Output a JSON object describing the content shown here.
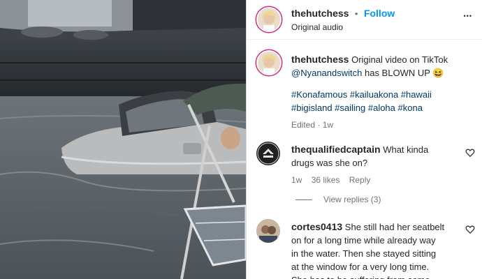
{
  "post": {
    "username": "thehutchess",
    "separator": "•",
    "follow_label": "Follow",
    "audio": "Original audio",
    "more_label": "•••"
  },
  "caption": {
    "username": "thehutchess",
    "text_line1": "Original video on TikTok",
    "mention": "@Nyanandswitch",
    "text_line2_rest": "has BLOWN UP 😆",
    "hashtags_line1": "#Konafamous #kailuakona #hawaii",
    "hashtags_line2": "#bigisland #sailing #aloha #kona",
    "meta": "Edited · 1w"
  },
  "comments": [
    {
      "username": "thequalifiedcaptain",
      "text_line1": "What kinda",
      "text_line2": "drugs was she on?",
      "time": "1w",
      "likes": "36 likes",
      "reply": "Reply",
      "view_replies": "View replies (3)",
      "avatar_text": "QUALIFIED CAPTAIN"
    },
    {
      "username": "cortes0413",
      "text_line1": "She still had her seatbelt",
      "text_line2": "on for a long time while already way",
      "text_line3": "in the water. Then she stayed sitting",
      "text_line4": "at the window for a very long time.",
      "text_line5": "She has to be suffering from some"
    }
  ],
  "colors": {
    "accent_blue": "#0095f6",
    "story_ring": "#d62976",
    "text_primary": "#262626",
    "text_secondary": "#737373"
  },
  "icons": [
    "more-icon",
    "heart-icon",
    "avatar"
  ]
}
